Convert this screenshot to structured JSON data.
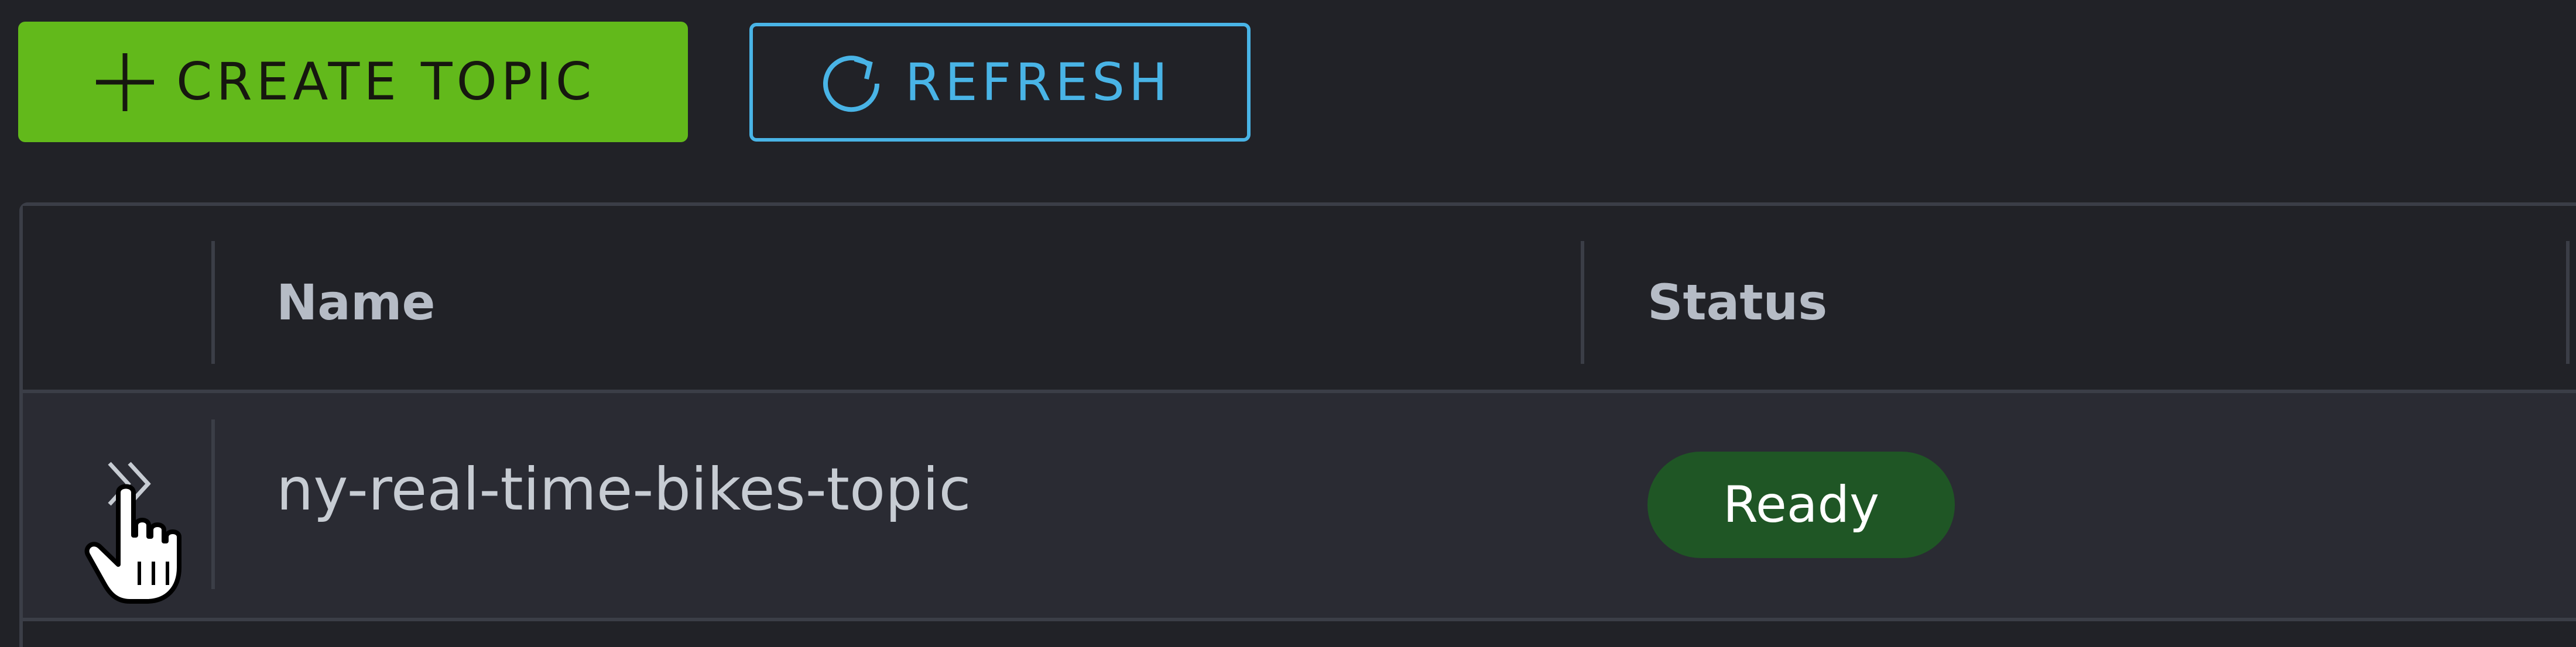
{
  "toolbar": {
    "create_label": "CREATE TOPIC",
    "create_icon": "plus-icon",
    "refresh_label": "REFRESH",
    "refresh_icon": "refresh-icon"
  },
  "table": {
    "columns": [
      "Name",
      "Status"
    ],
    "rows": [
      {
        "name": "ny-real-time-bikes-topic",
        "status": "Ready",
        "expander_icon": "double-chevron-right-icon"
      }
    ]
  },
  "colors": {
    "background": "#212227",
    "create_button": "#62b91b",
    "refresh_accent": "#49b4e6",
    "status_ready": "#1f5625"
  },
  "cursor": "hand-pointer-cursor"
}
